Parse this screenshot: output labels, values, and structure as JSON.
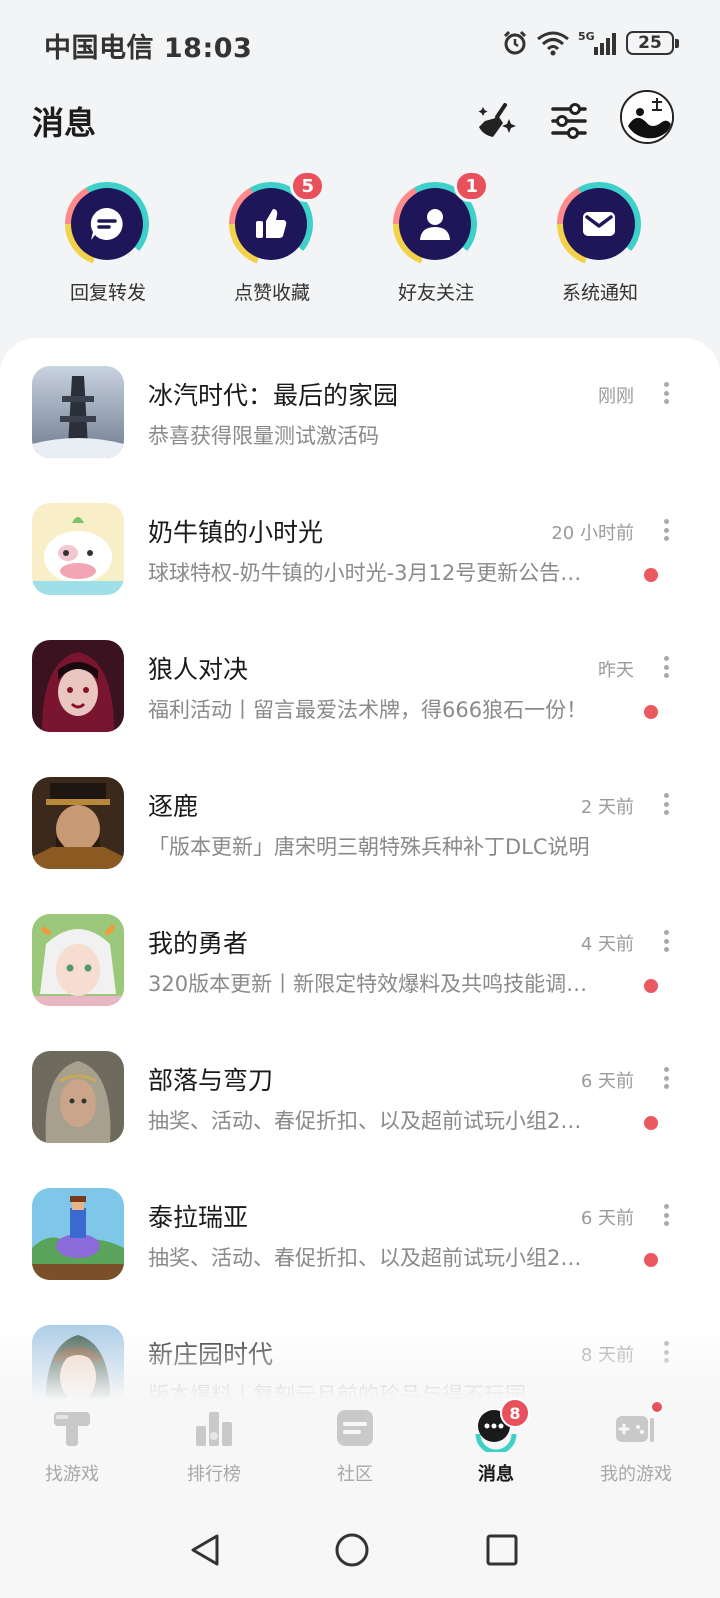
{
  "status_bar": {
    "carrier_time": "中国电信 18:03",
    "battery": "25",
    "network": "5G"
  },
  "header": {
    "title": "消息"
  },
  "categories": [
    {
      "label": "回复转发",
      "icon": "chat-bubble-icon",
      "badge": ""
    },
    {
      "label": "点赞收藏",
      "icon": "thumbs-up-icon",
      "badge": "5"
    },
    {
      "label": "好友关注",
      "icon": "person-icon",
      "badge": "1"
    },
    {
      "label": "系统通知",
      "icon": "envelope-icon",
      "badge": ""
    }
  ],
  "messages": [
    {
      "title": "冰汽时代：最后的家园",
      "time": "刚刚",
      "preview": "恭喜获得限量测试激活码",
      "unread": false
    },
    {
      "title": "奶牛镇的小时光",
      "time": "20 小时前",
      "preview": "球球特权-奶牛镇的小时光-3月12号更新公告…",
      "unread": true
    },
    {
      "title": "狼人对决",
      "time": "昨天",
      "preview": "福利活动丨留言最爱法术牌，得666狼石一份！",
      "unread": true
    },
    {
      "title": "逐鹿",
      "time": "2 天前",
      "preview": "「版本更新」唐宋明三朝特殊兵种补丁DLC说明",
      "unread": false
    },
    {
      "title": "我的勇者",
      "time": "4 天前",
      "preview": "320版本更新丨新限定特效爆料及共鸣技能调…",
      "unread": true
    },
    {
      "title": "部落与弯刀",
      "time": "6 天前",
      "preview": "抽奖、活动、春促折扣、以及超前试玩小组2…",
      "unread": true
    },
    {
      "title": "泰拉瑞亚",
      "time": "6 天前",
      "preview": "抽奖、活动、春促折扣、以及超前试玩小组2…",
      "unread": true
    },
    {
      "title": "新庄园时代",
      "time": "8 天前",
      "preview": "版本爆料丨复刻元旦前的珍品与得不玩园…",
      "unread": true
    }
  ],
  "bottom_nav": [
    {
      "label": "找游戏",
      "icon": "find-game-icon",
      "active": false
    },
    {
      "label": "排行榜",
      "icon": "ranking-icon",
      "active": false
    },
    {
      "label": "社区",
      "icon": "community-icon",
      "active": false
    },
    {
      "label": "消息",
      "icon": "message-icon",
      "active": true,
      "badge": "8"
    },
    {
      "label": "我的游戏",
      "icon": "my-games-icon",
      "active": false
    }
  ],
  "colors": {
    "accent": "#e8505b",
    "icon_dark": "#1e1659",
    "teal": "#3fd1c9"
  }
}
